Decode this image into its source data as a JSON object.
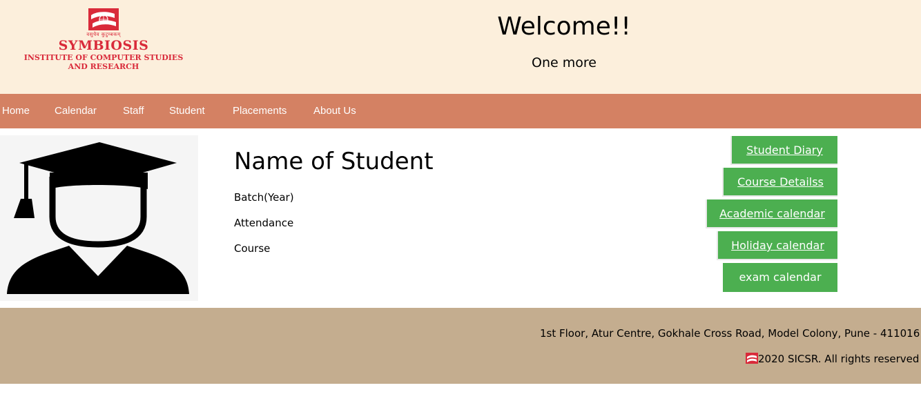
{
  "header": {
    "logo": {
      "tagline": "वसुधैव कुटुम्बकम्",
      "name": "SYMBIOSIS",
      "subtitle_line1": "INSTITUTE OF COMPUTER STUDIES",
      "subtitle_line2": "AND RESEARCH",
      "color": "#d92a3a"
    },
    "title": "Welcome!!",
    "subtitle": "One more"
  },
  "nav": {
    "items": [
      {
        "label": "Home"
      },
      {
        "label": "Calendar"
      },
      {
        "label": "Staff"
      },
      {
        "label": "Student"
      },
      {
        "label": "Placements"
      },
      {
        "label": "About Us"
      }
    ]
  },
  "profile": {
    "avatar_icon": "graduate-icon",
    "name": "Name of Student",
    "batch_label": "Batch(Year)",
    "attendance_label": "Attendance",
    "course_label": "Course"
  },
  "side_buttons": {
    "student_diary": "Student Diary",
    "course_details": "Course Detailss",
    "academic_calendar": "Academic calendar",
    "holiday_calendar": "Holiday calendar",
    "exam_calendar": "exam calendar",
    "color": "#4caf50"
  },
  "footer": {
    "address": "1st Floor, Atur Centre, Gokhale Cross Road, Model Colony, Pune - 411016",
    "copyright": "2020 SICSR. All rights reserved"
  },
  "colors": {
    "header_bg": "#fcefdc",
    "nav_bg": "#d48163",
    "footer_bg": "#c4ad8f"
  }
}
